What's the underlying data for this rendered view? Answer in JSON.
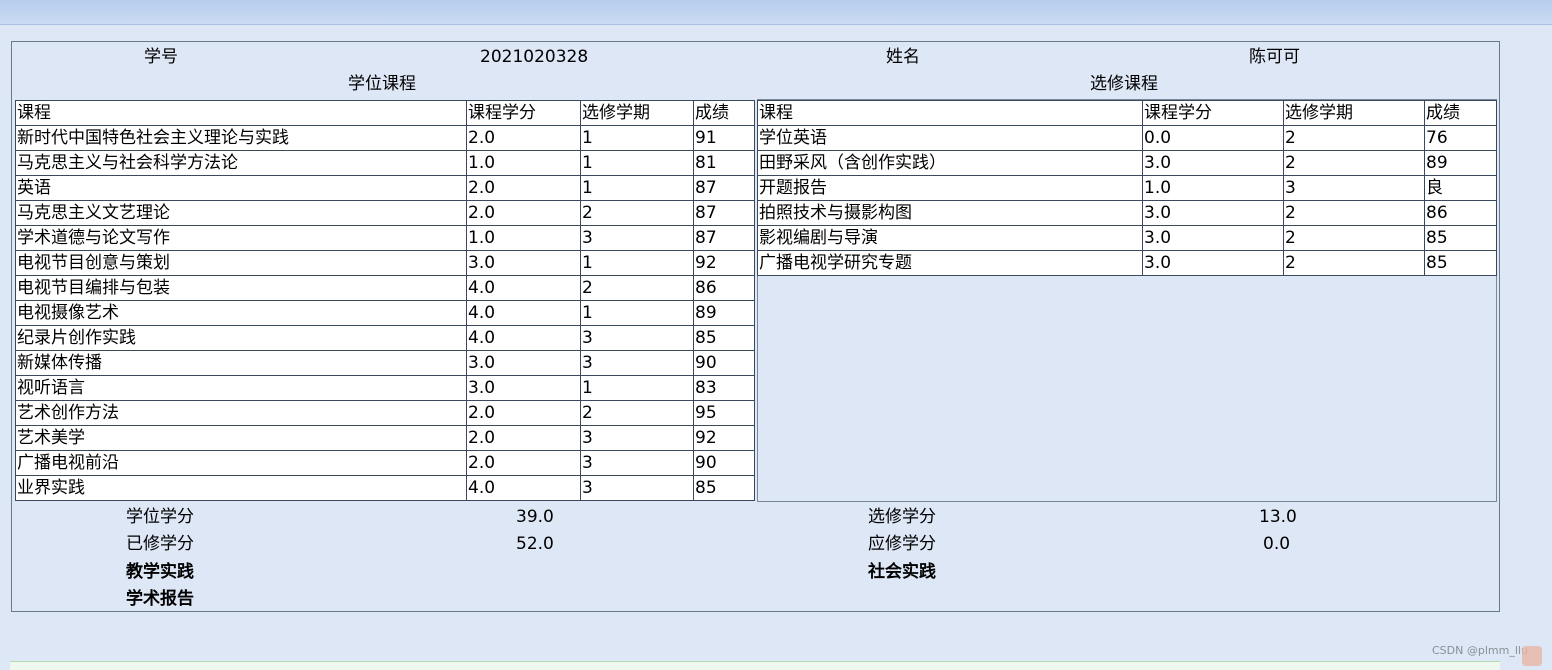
{
  "header": {
    "student_id_label": "学号",
    "student_id_value": "2021020328",
    "name_label": "姓名",
    "name_value": "陈可可"
  },
  "degree_courses": {
    "title": "学位课程",
    "columns": [
      "课程",
      "课程学分",
      "选修学期",
      "成绩"
    ],
    "rows": [
      [
        "新时代中国特色社会主义理论与实践",
        "2.0",
        "1",
        "91"
      ],
      [
        "马克思主义与社会科学方法论",
        "1.0",
        "1",
        "81"
      ],
      [
        "英语",
        "2.0",
        "1",
        "87"
      ],
      [
        "马克思主义文艺理论",
        "2.0",
        "2",
        "87"
      ],
      [
        "学术道德与论文写作",
        "1.0",
        "3",
        "87"
      ],
      [
        "电视节目创意与策划",
        "3.0",
        "1",
        "92"
      ],
      [
        "电视节目编排与包装",
        "4.0",
        "2",
        "86"
      ],
      [
        "电视摄像艺术",
        "4.0",
        "1",
        "89"
      ],
      [
        "纪录片创作实践",
        "4.0",
        "3",
        "85"
      ],
      [
        "新媒体传播",
        "3.0",
        "3",
        "90"
      ],
      [
        "视听语言",
        "3.0",
        "1",
        "83"
      ],
      [
        "艺术创作方法",
        "2.0",
        "2",
        "95"
      ],
      [
        "艺术美学",
        "2.0",
        "3",
        "92"
      ],
      [
        "广播电视前沿",
        "2.0",
        "3",
        "90"
      ],
      [
        "业界实践",
        "4.0",
        "3",
        "85"
      ]
    ]
  },
  "elective_courses": {
    "title": "选修课程",
    "columns": [
      "课程",
      "课程学分",
      "选修学期",
      "成绩"
    ],
    "rows": [
      [
        "学位英语",
        "0.0",
        "2",
        "76"
      ],
      [
        "田野采风（含创作实践）",
        "3.0",
        "2",
        "89"
      ],
      [
        "开题报告",
        "1.0",
        "3",
        "良"
      ],
      [
        "拍照技术与摄影构图",
        "3.0",
        "2",
        "86"
      ],
      [
        "影视编剧与导演",
        "3.0",
        "2",
        "85"
      ],
      [
        "广播电视学研究专题",
        "3.0",
        "2",
        "85"
      ]
    ]
  },
  "summary": {
    "degree_credits_label": "学位学分",
    "degree_credits_value": "39.0",
    "elective_credits_label": "选修学分",
    "elective_credits_value": "13.0",
    "earned_credits_label": "已修学分",
    "earned_credits_value": "52.0",
    "required_credits_label": "应修学分",
    "required_credits_value": "0.0",
    "teaching_practice_label": "教学实践",
    "social_practice_label": "社会实践",
    "academic_report_label": "学术报告"
  },
  "watermark": "CSDN @plmm_llu",
  "colors": {
    "background": "#dde7f5",
    "table_border": "#3a4a5c",
    "table_bg": "#ffffff"
  }
}
